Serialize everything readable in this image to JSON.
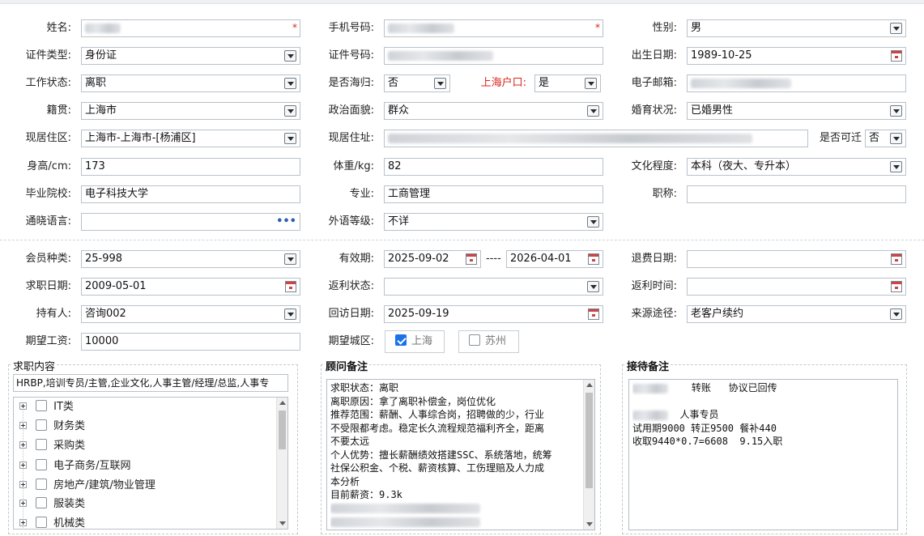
{
  "basic": {
    "name_label": "姓名:",
    "phone_label": "手机号码:",
    "gender_label": "性别:",
    "gender_value": "男",
    "idtype_label": "证件类型:",
    "idtype_value": "身份证",
    "idnum_label": "证件号码:",
    "birth_label": "出生日期:",
    "birth_value": "1989-10-25",
    "workstatus_label": "工作状态:",
    "workstatus_value": "离职",
    "returnee_label": "是否海归:",
    "returnee_value": "否",
    "shanghai_label": "上海户口:",
    "shanghai_value": "是",
    "email_label": "电子邮箱:",
    "native_label": "籍贯:",
    "native_value": "上海市",
    "political_label": "政治面貌:",
    "political_value": "群众",
    "marital_label": "婚育状况:",
    "marital_value": "已婚男性",
    "residence_label": "现居住区:",
    "residence_value": "上海市-上海市-[杨浦区]",
    "address_label": "现居住址:",
    "relocate_label": "是否可迁",
    "relocate_value": "否",
    "height_label": "身高/cm:",
    "height_value": "173",
    "weight_label": "体重/kg:",
    "weight_value": "82",
    "education_label": "文化程度:",
    "education_value": "本科（夜大、专升本）",
    "school_label": "毕业院校:",
    "school_value": "电子科技大学",
    "major_label": "专业:",
    "major_value": "工商管理",
    "title_label": "职称:",
    "language_label": "通晓语言:",
    "foreign_label": "外语等级:",
    "foreign_value": "不详",
    "required_mark": "*"
  },
  "member": {
    "type_label": "会员种类:",
    "type_value": "25-998",
    "valid_label": "有效期:",
    "valid_from": "2025-09-02",
    "valid_sep": "----",
    "valid_to": "2026-04-01",
    "refund_label": "退费日期:",
    "jobdate_label": "求职日期:",
    "jobdate_value": "2009-05-01",
    "rebate_label": "返利状态:",
    "rebatetime_label": "返利时间:",
    "holder_label": "持有人:",
    "holder_value": "咨询002",
    "visit_label": "回访日期:",
    "visit_value": "2025-09-19",
    "source_label": "来源途径:",
    "source_value": "老客户续约",
    "salary_label": "期望工资:",
    "salary_value": "10000",
    "city_label": "期望城区:",
    "city_shanghai": "上海",
    "city_suzhou": "苏州"
  },
  "job_panel": {
    "title": "求职内容",
    "summary": "HRBP,培训专员/主管,企业文化,人事主管/经理/总监,人事专",
    "tree": [
      "IT类",
      "财务类",
      "采购类",
      "电子商务/互联网",
      "房地产/建筑/物业管理",
      "服装类",
      "机械类"
    ]
  },
  "advisor_panel": {
    "title": "顾问备注",
    "lines": [
      "求职状态：离职",
      "离职原因：拿了离职补偿金，岗位优化",
      "推荐范围：薪酬、人事综合岗，招聘做的少，行业",
      "不受限都考虑。稳定长久流程规范福利齐全，距离",
      "不要太远",
      "个人优势：擅长薪酬绩效搭建SSC、系统落地，统筹",
      "社保公积金、个税、薪资核算、工伤理赔及人力成",
      "本分析",
      "目前薪资：9.3k"
    ]
  },
  "reception_panel": {
    "title": "接待备注",
    "line1_a": "转账",
    "line1_b": "协议已回传",
    "line2": "人事专员",
    "line3": "试用期9000 转正9500 餐补440",
    "line4": "收取9440*0.7=6608  9.15入职"
  }
}
